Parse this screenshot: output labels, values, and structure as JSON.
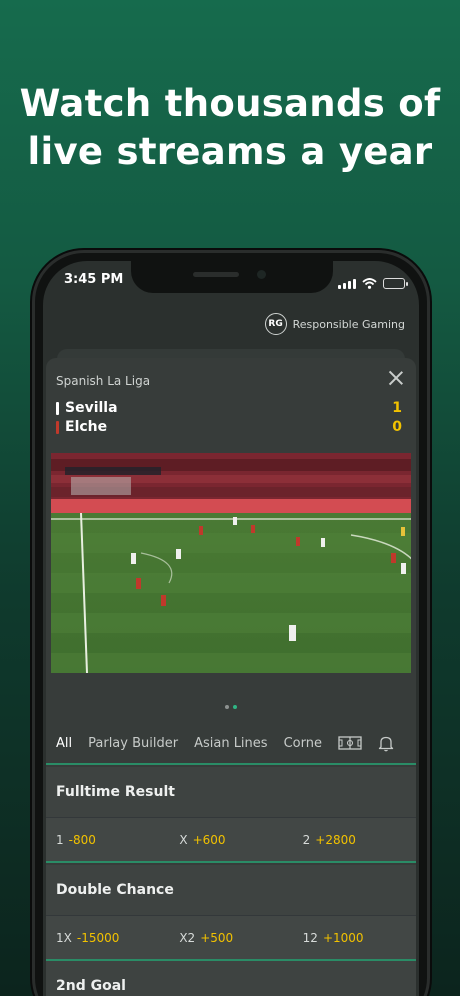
{
  "headline": {
    "line1": "Watch thousands of",
    "line2": "live streams a year"
  },
  "status": {
    "time": "3:45 PM"
  },
  "responsible": {
    "logo": "RG",
    "label": "Responsible Gaming"
  },
  "match": {
    "league": "Spanish La Liga",
    "home": {
      "name": "Sevilla",
      "score": "1",
      "color": "#ffffff"
    },
    "away": {
      "name": "Elche",
      "score": "0",
      "color": "#c0392b"
    }
  },
  "tabs": {
    "all": "All",
    "parlay": "Parlay Builder",
    "asian": "Asian Lines",
    "corners": "Corne"
  },
  "markets": {
    "fulltime": {
      "title": "Fulltime Result",
      "options": [
        {
          "label": "1",
          "odds": "-800"
        },
        {
          "label": "X",
          "odds": "+600"
        },
        {
          "label": "2",
          "odds": "+2800"
        }
      ]
    },
    "double": {
      "title": "Double Chance",
      "options": [
        {
          "label": "1X",
          "odds": "-15000"
        },
        {
          "label": "X2",
          "odds": "+500"
        },
        {
          "label": "12",
          "odds": "+1000"
        }
      ]
    },
    "second_goal": {
      "title": "2nd Goal"
    }
  },
  "colors": {
    "accent": "#2a8c66",
    "odds": "#f2c200",
    "page_top": "#166b4d",
    "page_bottom": "#0c241d"
  },
  "icons": [
    "signal-icon",
    "wifi-icon",
    "battery-icon",
    "close-icon",
    "pitch-icon",
    "bell-icon"
  ]
}
